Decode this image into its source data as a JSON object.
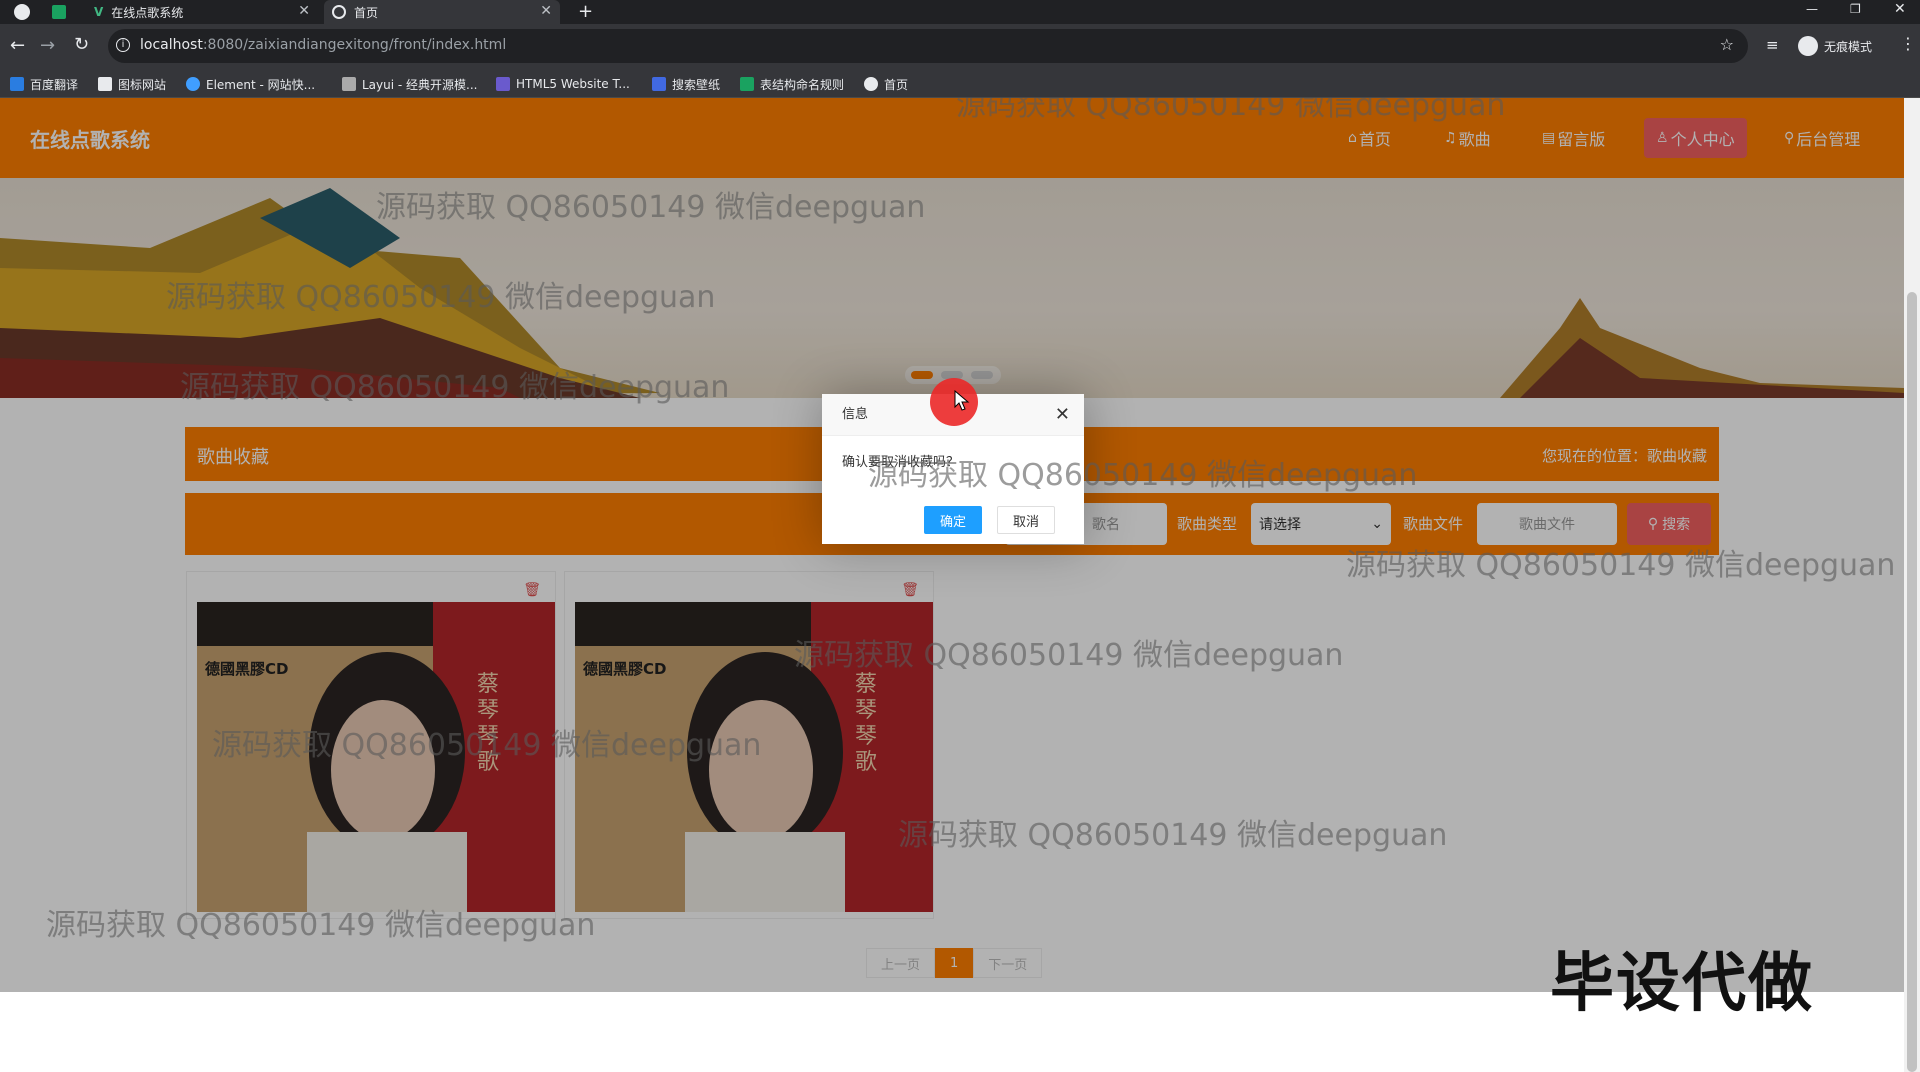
{
  "browser": {
    "tabs": [
      {
        "title": "在线点歌系统",
        "active": false
      },
      {
        "title": "首页",
        "active": true
      }
    ],
    "new_tab_label": "+",
    "url_host": "localhost",
    "url_rest": ":8080/zaixiandiangexitong/front/index.html",
    "profile_label": "无痕模式",
    "bookmarks": [
      "百度翻译",
      "图标网站",
      "Element - 网站快...",
      "Layui - 经典开源模...",
      "HTML5 Website T...",
      "搜索壁纸",
      "表结构命名规则",
      "首页"
    ]
  },
  "site": {
    "title": "在线点歌系统",
    "nav": [
      "首页",
      "歌曲",
      "留言版",
      "个人中心",
      "后台管理"
    ]
  },
  "section": {
    "title": "歌曲收藏",
    "breadcrumb_prefix": "您现在的位置：",
    "breadcrumb_current": "歌曲收藏"
  },
  "filters": {
    "name_placeholder": "歌名",
    "type_label": "歌曲类型",
    "type_selected": "请选择",
    "file_label": "歌曲文件",
    "file_placeholder": "歌曲文件",
    "search_label": "搜索"
  },
  "cards": [
    {
      "cover_text_left": "德國黑膠CD",
      "cover_text_name": "蔡琴琴歌"
    },
    {
      "cover_text_left": "德國黑膠CD",
      "cover_text_name": "蔡琴琴歌"
    }
  ],
  "pager": {
    "prev": "上一页",
    "current": "1",
    "next": "下一页"
  },
  "dialog": {
    "title": "信息",
    "message": "确认要取消收藏吗？",
    "ok": "确定",
    "cancel": "取消"
  },
  "watermark": "源码获取 QQ86050149 微信deepguan",
  "stamp": "毕设代做",
  "colors": {
    "brand": "#ff7f00",
    "accent": "#f26060",
    "dialog_ok": "#1e9fff"
  }
}
